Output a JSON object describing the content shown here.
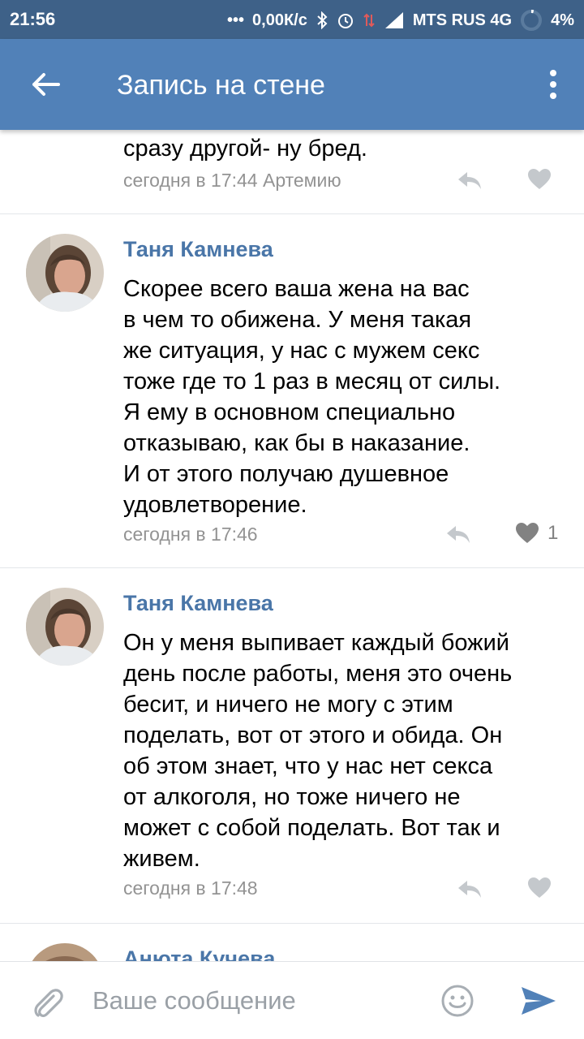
{
  "status_bar": {
    "time": "21:56",
    "speed": "0,00К/с",
    "carrier": "MTS RUS 4G",
    "battery": "4%"
  },
  "app_bar": {
    "title": "Запись на стене",
    "back_icon": "arrow-back-icon",
    "menu_icon": "more-vertical-icon"
  },
  "comments": [
    {
      "text": "сразу другой- ну бред.",
      "meta": "сегодня в 17:44 Артемию"
    },
    {
      "author": "Таня Камнева",
      "text": "Скорее всего ваша жена на вас\nв чем то обижена. У меня такая\nже ситуация, у нас с мужем секс\nтоже где то 1 раз в месяц от силы.\nЯ ему в основном специально\nотказываю, как бы в наказание.\nИ от этого получаю душевное\nудовлетворение.",
      "meta": "сегодня в 17:46",
      "likes": "1"
    },
    {
      "author": "Таня Камнева",
      "text": "Он у меня выпивает каждый божий\nдень после работы, меня это очень\nбесит, и ничего не могу с этим\nподелать, вот от этого и обида. Он\nоб этом знает, что у нас нет секса\nот алкоголя, но тоже ничего не\nможет с собой поделать. Вот так и\nживем.",
      "meta": "сегодня в 17:48"
    },
    {
      "author": "Анюта Кучева"
    }
  ],
  "composer": {
    "placeholder": "Ваше сообщение"
  },
  "colors": {
    "status_bar": "#3e6188",
    "app_bar": "#5181b8",
    "author": "#4a76a8",
    "meta": "#939393",
    "icon": "#c4c8cc",
    "send": "#5181b8"
  }
}
